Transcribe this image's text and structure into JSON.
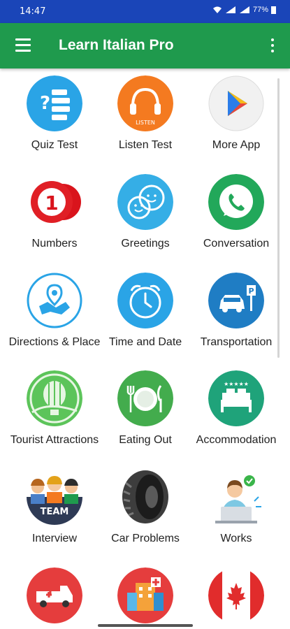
{
  "status": {
    "time": "14:47",
    "battery": "77%"
  },
  "app": {
    "title": "Learn Italian Pro"
  },
  "items": [
    {
      "label": "Quiz Test"
    },
    {
      "label": "Listen Test",
      "badge": "LISTEN"
    },
    {
      "label": "More App"
    },
    {
      "label": "Numbers"
    },
    {
      "label": "Greetings"
    },
    {
      "label": "Conversation"
    },
    {
      "label": "Directions & Place"
    },
    {
      "label": "Time and Date"
    },
    {
      "label": "Transportation"
    },
    {
      "label": "Tourist Attractions"
    },
    {
      "label": "Eating Out"
    },
    {
      "label": "Accommodation"
    },
    {
      "label": "Interview",
      "badge": "TEAM"
    },
    {
      "label": "Car Problems"
    },
    {
      "label": "Works"
    },
    {
      "label": ""
    },
    {
      "label": ""
    },
    {
      "label": ""
    }
  ]
}
